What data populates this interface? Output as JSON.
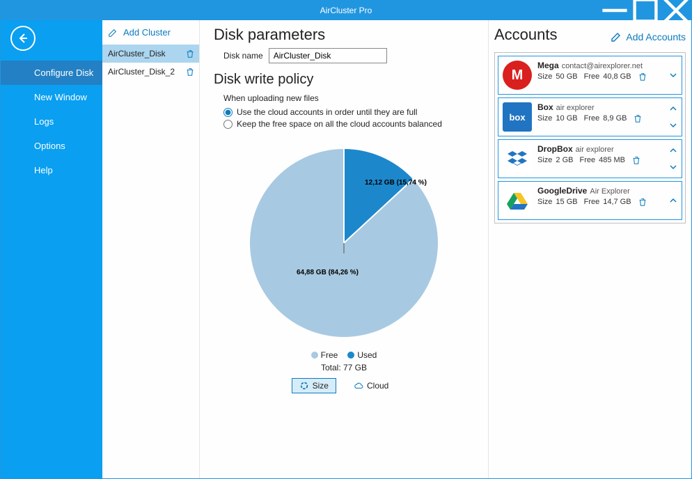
{
  "app": {
    "title": "AirCluster Pro"
  },
  "nav": {
    "items": [
      {
        "label": "Configure Disk",
        "active": true
      },
      {
        "label": "New Window"
      },
      {
        "label": "Logs"
      },
      {
        "label": "Options"
      },
      {
        "label": "Help"
      }
    ]
  },
  "cluster_list": {
    "add_label": "Add Cluster",
    "items": [
      {
        "name": "AirCluster_Disk",
        "selected": true
      },
      {
        "name": "AirCluster_Disk_2"
      }
    ]
  },
  "main": {
    "params_title": "Disk parameters",
    "disk_name_label": "Disk name",
    "disk_name_value": "AirCluster_Disk",
    "policy_title": "Disk write policy",
    "policy_sub": "When uploading new files",
    "policy_options": [
      {
        "label": "Use the cloud accounts in order until they are full",
        "checked": true
      },
      {
        "label": "Keep the free space on all the cloud accounts balanced",
        "checked": false
      }
    ],
    "legend": {
      "free": "Free",
      "used": "Used"
    },
    "total_label": "Total: 77 GB",
    "toggle": {
      "size": "Size",
      "cloud": "Cloud"
    }
  },
  "chart_data": {
    "type": "pie",
    "title": "",
    "series": [
      {
        "name": "Used",
        "value": 12.12,
        "percent": 15.74,
        "label": "12,12 GB (15,74 %)",
        "color": "#1d87cc"
      },
      {
        "name": "Free",
        "value": 64.88,
        "percent": 84.26,
        "label": "64,88 GB (84,26 %)",
        "color": "#a8c9e2"
      }
    ],
    "total": 77,
    "unit": "GB"
  },
  "colors": {
    "free": "#a8c9e2",
    "used": "#1d87cc",
    "accent": "#0a7bbf"
  },
  "accounts": {
    "title": "Accounts",
    "add_label": "Add Accounts",
    "labels": {
      "size": "Size",
      "free": "Free"
    },
    "items": [
      {
        "name": "Mega",
        "user": "contact@airexplorer.net",
        "size": "50 GB",
        "free": "40,8 GB",
        "icon_bg": "#da1f1f",
        "icon_label": "M",
        "sort": "down"
      },
      {
        "name": "Box",
        "user": "air explorer",
        "size": "10 GB",
        "free": "8,9 GB",
        "icon_bg": "#2074c2",
        "icon_label": "box",
        "sort": "both"
      },
      {
        "name": "DropBox",
        "user": "air explorer",
        "size": "2 GB",
        "free": "485 MB",
        "icon_bg": "#ffffff",
        "icon_label": "dropbox",
        "sort": "both"
      },
      {
        "name": "GoogleDrive",
        "user": "Air Explorer",
        "size": "15 GB",
        "free": "14,7 GB",
        "icon_bg": "#ffffff",
        "icon_label": "drive",
        "sort": "up"
      }
    ]
  }
}
